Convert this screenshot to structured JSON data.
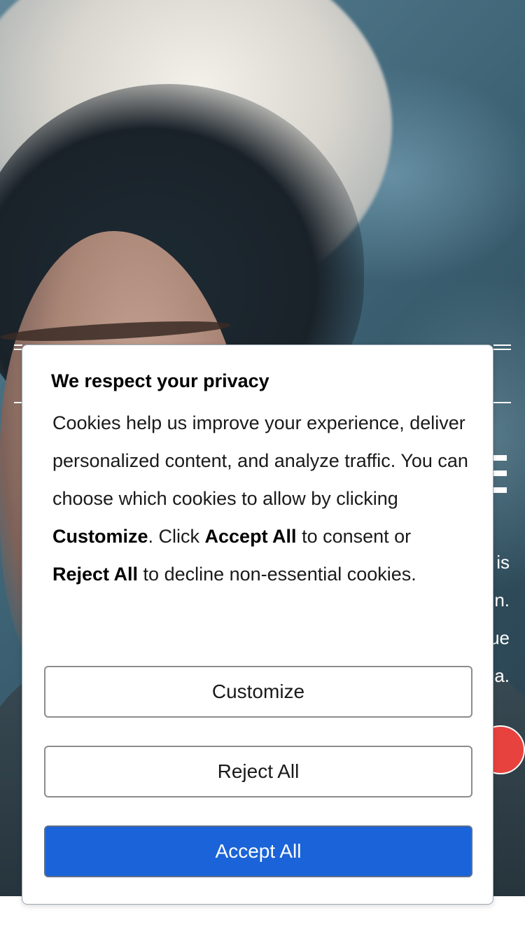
{
  "colors": {
    "accent": "#1a63d9",
    "dialog_background": "#ffffff",
    "button_border": "#8c8c8c",
    "badge_red": "#e8423f"
  },
  "background": {
    "image": "hero-photo of woman in fur-trimmed hood",
    "peek_text_lines": [
      "is",
      "n.",
      "ue",
      "a."
    ],
    "peek_icons": [
      "hamburger-menu-icon",
      "site-logo-icon"
    ]
  },
  "consent": {
    "title": "We respect your privacy",
    "body": {
      "part1": "Cookies help us improve your experience, deliver personalized content, and analyze traffic. You can choose which cookies to allow by clicking ",
      "customize_word": "Customize",
      "part2": ". Click ",
      "accept_word": "Accept All",
      "part3": " to consent or ",
      "reject_word": "Reject All",
      "part4": " to decline non-essential cookies."
    },
    "buttons": {
      "customize": "Customize",
      "reject": "Reject All",
      "accept": "Accept All"
    }
  }
}
